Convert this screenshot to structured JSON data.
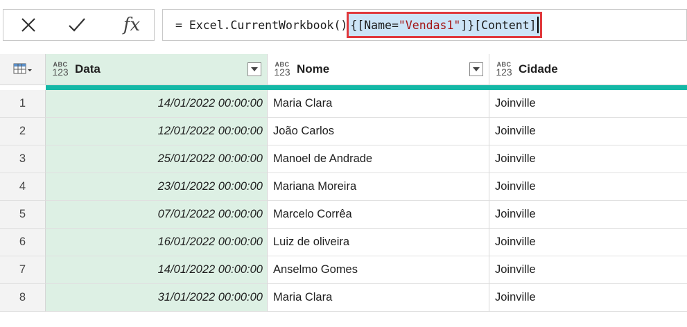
{
  "formula_bar": {
    "fx_label": "fx",
    "prefix": "= Excel.CurrentWorkbook()",
    "highlight_part1": "{[Name=",
    "highlight_string": "\"Vendas1\"",
    "highlight_part2": "]}[Content]"
  },
  "columns": [
    {
      "type_top": "ABC",
      "type_bottom": "123",
      "name": "Data"
    },
    {
      "type_top": "ABC",
      "type_bottom": "123",
      "name": "Nome"
    },
    {
      "type_top": "ABC",
      "type_bottom": "123",
      "name": "Cidade"
    }
  ],
  "rows": [
    {
      "num": "1",
      "data": "14/01/2022 00:00:00",
      "nome": "Maria Clara",
      "cidade": "Joinville"
    },
    {
      "num": "2",
      "data": "12/01/2022 00:00:00",
      "nome": "João Carlos",
      "cidade": "Joinville"
    },
    {
      "num": "3",
      "data": "25/01/2022 00:00:00",
      "nome": "Manoel de Andrade",
      "cidade": "Joinville"
    },
    {
      "num": "4",
      "data": "23/01/2022 00:00:00",
      "nome": "Mariana Moreira",
      "cidade": "Joinville"
    },
    {
      "num": "5",
      "data": "07/01/2022 00:00:00",
      "nome": "Marcelo Corrêa",
      "cidade": "Joinville"
    },
    {
      "num": "6",
      "data": "16/01/2022 00:00:00",
      "nome": "Luiz de oliveira",
      "cidade": "Joinville"
    },
    {
      "num": "7",
      "data": "14/01/2022 00:00:00",
      "nome": "Anselmo Gomes",
      "cidade": "Joinville"
    },
    {
      "num": "8",
      "data": "31/01/2022 00:00:00",
      "nome": "Maria Clara",
      "cidade": "Joinville"
    }
  ],
  "colors": {
    "selected_column": "#ddf0e4",
    "highlight_fill": "#cce4f7",
    "highlight_border": "#e0383c",
    "quality_bar": "#14b8a6",
    "string_token": "#a31515"
  },
  "icons": {
    "cancel": "close-icon",
    "commit": "checkmark-icon",
    "table_menu": "table-icon",
    "filter": "chevron-down-icon"
  }
}
